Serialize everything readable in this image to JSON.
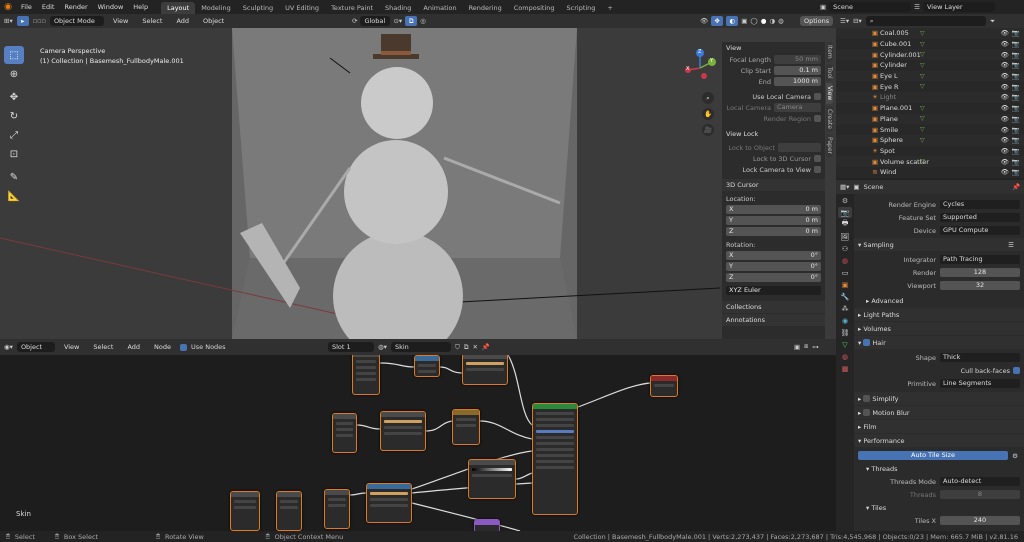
{
  "topbar": {
    "menus": [
      "File",
      "Edit",
      "Render",
      "Window",
      "Help"
    ],
    "workspaces": [
      "Layout",
      "Modeling",
      "Sculpting",
      "UV Editing",
      "Texture Paint",
      "Shading",
      "Animation",
      "Rendering",
      "Compositing",
      "Scripting"
    ],
    "active_workspace": "Layout",
    "add_tab": "+",
    "scene": "Scene",
    "view_layer": "View Layer"
  },
  "viewport": {
    "mode": "Object Mode",
    "menus": [
      "View",
      "Select",
      "Add",
      "Object"
    ],
    "orientation": "Global",
    "options": "Options",
    "overlay_title": "Camera Perspective",
    "overlay_subtitle": "(1) Collection | Basemesh_FullbodyMale.001",
    "gizmo": {
      "z": "Z",
      "y": "Y",
      "x": "X"
    }
  },
  "npanel": {
    "tabs": [
      "Item",
      "Tool",
      "View",
      "Create",
      "Paper"
    ],
    "active_tab": "View",
    "view_title": "View",
    "focal_length_label": "Focal Length",
    "focal_length": "50 mm",
    "clip_start_label": "Clip Start",
    "clip_start": "0.1 m",
    "clip_end_label": "End",
    "clip_end": "1000 m",
    "use_local_camera": "Use Local Camera",
    "local_camera_label": "Local Camera",
    "local_camera": "Camera",
    "render_region": "Render Region",
    "view_lock_title": "View Lock",
    "lock_to_object": "Lock to Object",
    "lock_3d_cursor": "Lock to 3D Cursor",
    "lock_camera": "Lock Camera to View",
    "cursor_title": "3D Cursor",
    "location_label": "Location:",
    "loc": [
      {
        "a": "X",
        "v": "0 m"
      },
      {
        "a": "Y",
        "v": "0 m"
      },
      {
        "a": "Z",
        "v": "0 m"
      }
    ],
    "rotation_label": "Rotation:",
    "rot": [
      {
        "a": "X",
        "v": "0°"
      },
      {
        "a": "Y",
        "v": "0°"
      },
      {
        "a": "Z",
        "v": "0°"
      }
    ],
    "rot_mode": "XYZ Euler",
    "collections": "Collections",
    "annotations": "Annotations"
  },
  "node_editor": {
    "type": "Object",
    "menus": [
      "View",
      "Select",
      "Add",
      "Node"
    ],
    "use_nodes": "Use Nodes",
    "slot": "Slot 1",
    "material": "Skin",
    "label": "Skin"
  },
  "outliner": {
    "items": [
      "Coal.005",
      "Cube.001",
      "Cylinder.001",
      "Cylinder",
      "Eye L",
      "Eye R",
      "Light",
      "Plane.001",
      "Plane",
      "Smile",
      "Sphere",
      "Spot",
      "Volume scatter",
      "Wind"
    ]
  },
  "properties": {
    "scene": "Scene",
    "render_engine_label": "Render Engine",
    "render_engine": "Cycles",
    "feature_set_label": "Feature Set",
    "feature_set": "Supported",
    "device_label": "Device",
    "device": "GPU Compute",
    "sampling": "Sampling",
    "integrator_label": "Integrator",
    "integrator": "Path Tracing",
    "render_label": "Render",
    "render": "128",
    "viewport_label": "Viewport",
    "viewport": "32",
    "advanced": "Advanced",
    "light_paths": "Light Paths",
    "volumes": "Volumes",
    "hair": "Hair",
    "shape_label": "Shape",
    "shape": "Thick",
    "cull": "Cull back-faces",
    "primitive_label": "Primitive",
    "primitive": "Line Segments",
    "simplify": "Simplify",
    "motion_blur": "Motion Blur",
    "film": "Film",
    "performance": "Performance",
    "auto_tile": "Auto Tile Size",
    "threads": "Threads",
    "threads_mode_label": "Threads Mode",
    "threads_mode": "Auto-detect",
    "threads_label": "Threads",
    "threads_val": "8",
    "tiles": "Tiles",
    "tiles_x_label": "Tiles X",
    "tiles_x": "240"
  },
  "status": {
    "select": "Select",
    "box_select": "Box Select",
    "rotate_view": "Rotate View",
    "context_menu": "Object Context Menu",
    "info": "Collection | Basemesh_FullbodyMale.001 | Verts:2,273,437 | Faces:2,273,687 | Tris:4,545,968 | Objects:0/23 | Mem: 665.7 MiB | v2.81.16"
  },
  "colors": {
    "accent": "#4772b3",
    "node_border": "#e07a20",
    "outliner_tri": "#78b44c"
  }
}
